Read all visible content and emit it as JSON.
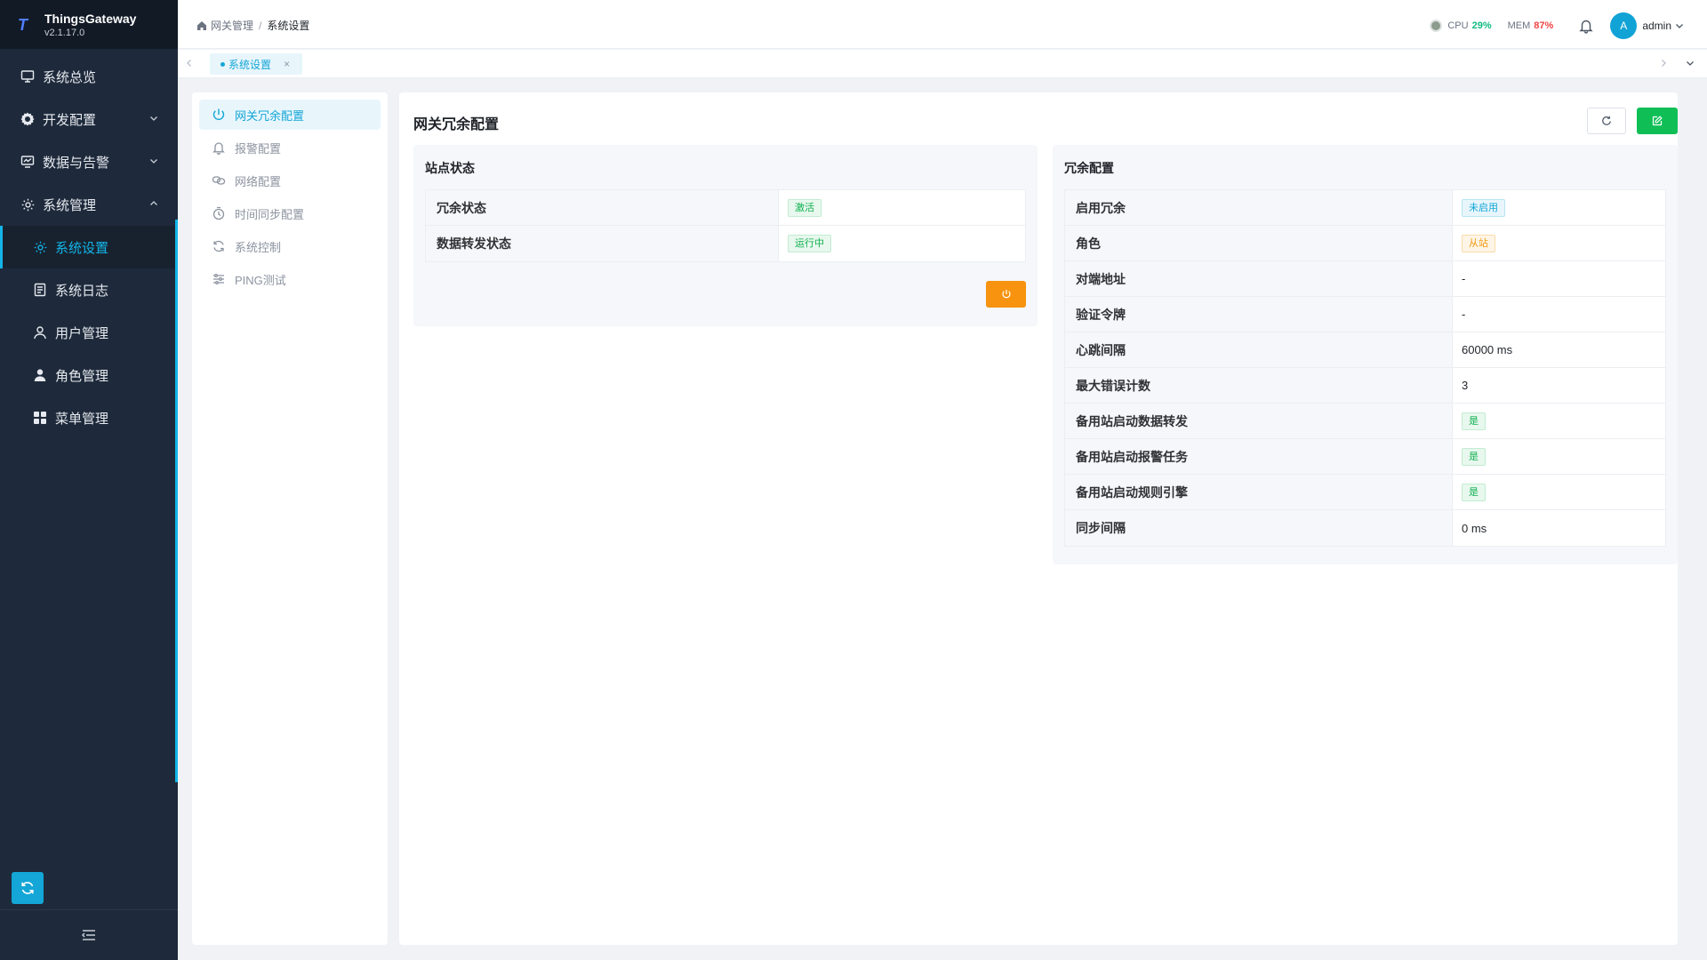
{
  "app": {
    "name": "ThingsGateway",
    "version": "v2.1.17.0"
  },
  "sidebar": {
    "items": [
      {
        "label": "系统总览"
      },
      {
        "label": "开发配置"
      },
      {
        "label": "数据与告警"
      },
      {
        "label": "系统管理"
      },
      {
        "label": "系统设置"
      },
      {
        "label": "系统日志"
      },
      {
        "label": "用户管理"
      },
      {
        "label": "角色管理"
      },
      {
        "label": "菜单管理"
      }
    ]
  },
  "header": {
    "breadcrumb": [
      "网关管理",
      "系统设置"
    ],
    "cpu_label": "CPU",
    "cpu_value": "29%",
    "mem_label": "MEM",
    "mem_value": "87%",
    "avatar_letter": "A",
    "user": "admin"
  },
  "tabs": [
    {
      "label": "系统设置",
      "close": "×"
    }
  ],
  "settings_nav": [
    {
      "label": "网关冗余配置"
    },
    {
      "label": "报警配置"
    },
    {
      "label": "网络配置"
    },
    {
      "label": "时间同步配置"
    },
    {
      "label": "系统控制"
    },
    {
      "label": "PING测试"
    }
  ],
  "main": {
    "title": "网关冗余配置",
    "station_status": {
      "title": "站点状态",
      "rows": [
        {
          "label": "冗余状态",
          "value": "激活"
        },
        {
          "label": "数据转发状态",
          "value": "运行中"
        }
      ]
    },
    "redundancy_config": {
      "title": "冗余配置",
      "rows": [
        {
          "label": "启用冗余",
          "value": "未启用"
        },
        {
          "label": "角色",
          "value": "从站"
        },
        {
          "label": "对端地址",
          "value": "-"
        },
        {
          "label": "验证令牌",
          "value": "-"
        },
        {
          "label": "心跳间隔",
          "value": "60000 ms"
        },
        {
          "label": "最大错误计数",
          "value": "3"
        },
        {
          "label": "备用站启动数据转发",
          "value": "是"
        },
        {
          "label": "备用站启动报警任务",
          "value": "是"
        },
        {
          "label": "备用站启动规则引擎",
          "value": "是"
        },
        {
          "label": "同步间隔",
          "value": "0 ms"
        }
      ]
    }
  },
  "colors": {
    "accent": "#13a6d6",
    "sidebar_bg": "#1e2a3b",
    "success": "#0fbf56",
    "warning": "#f7930e",
    "danger": "#ef4444"
  }
}
